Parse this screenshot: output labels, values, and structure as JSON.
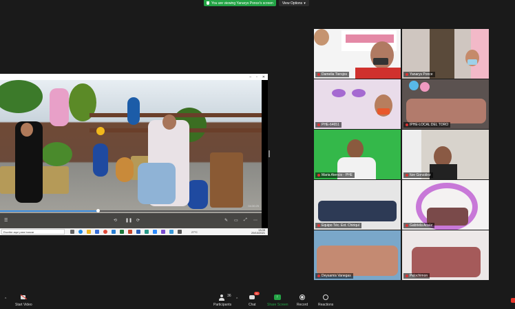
{
  "banner": {
    "viewing_text": "You are viewing Yanarys Ponce's screen",
    "view_options": "View Options"
  },
  "shared_video": {
    "time_readout": "04:30:25",
    "search_placeholder": "Escribe aquí para buscar",
    "tray_temp": "27°C",
    "tray_time": "13:09",
    "tray_date": "29/10/2021"
  },
  "gallery": [
    {
      "name": "Damelia Tiersjos"
    },
    {
      "name": "Yanarys Ponce"
    },
    {
      "name": "PHE-64651"
    },
    {
      "name": "IPHE-LOCAL DEL TORO"
    },
    {
      "name": "Maria Atencio - PHE"
    },
    {
      "name": "Itze González"
    },
    {
      "name": "Equipo Téc. Ext. Chiriquí"
    },
    {
      "name": "Gabriela Araúz"
    },
    {
      "name": "Deysamis Vanegas"
    },
    {
      "name": "Pelochimon"
    }
  ],
  "toolbar": {
    "start_video": "Start Video",
    "participants": "Participants",
    "participants_count": "36",
    "chat": "Chat",
    "chat_badge": "51",
    "share_screen": "Share Screen",
    "record": "Record",
    "reactions": "Reactions"
  },
  "colors": {
    "share_green": "#23a345",
    "progress_blue": "#3b8de0",
    "badge_red": "#e8372c"
  }
}
